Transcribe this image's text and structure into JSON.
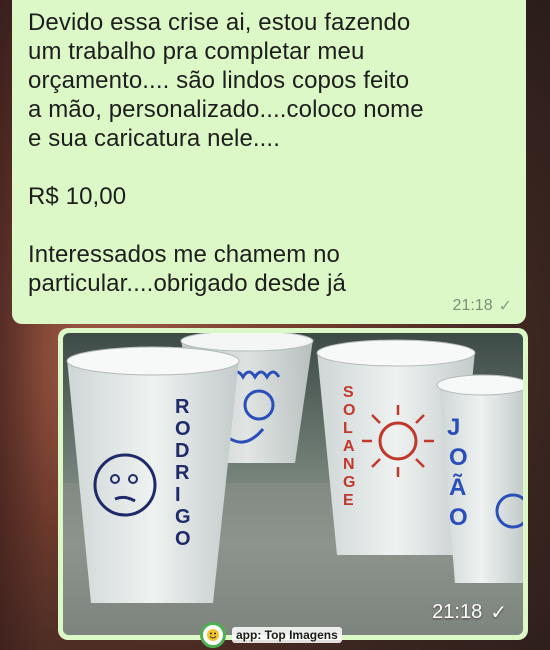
{
  "message_text": {
    "lines": [
      "Devido essa crise ai, estou fazendo",
      "um trabalho pra completar meu",
      "orçamento.... são lindos copos feito",
      "a mão, personalizado....coloco nome",
      "e sua caricatura nele....",
      "R$ 10,00",
      "Interessados me chamem no",
      "particular....obrigado desde já"
    ],
    "time": "21:18",
    "status_icon": "double-check-icon"
  },
  "message_photo": {
    "cup_names": [
      "RODRIGO",
      "SOLANGE",
      "JOÃO"
    ],
    "time": "21:18",
    "status_icon": "double-check-icon"
  },
  "watermark": {
    "label": "app: Top Imagens",
    "icon": "smiley-logo-icon"
  },
  "colors": {
    "bubble": "#dcf8c6",
    "meta": "#7c8f76",
    "marker": "#2b4fb8",
    "marker_red": "#c0392b"
  }
}
